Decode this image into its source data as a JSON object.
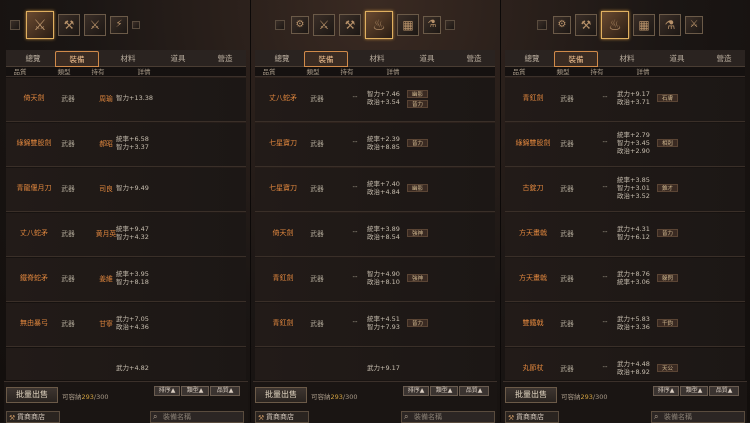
{
  "columns": {
    "grade": "品質",
    "type": "類型",
    "owner": "持有",
    "detail": "詳情"
  },
  "tabs": [
    "總覽",
    "裝備",
    "材料",
    "道具",
    "營造"
  ],
  "footer": {
    "sell": "批量出售",
    "capacity_label": "可容納",
    "capacity_used": "293",
    "capacity_total": "/300",
    "sort": [
      "排序▲",
      "類型▲",
      "品質▲"
    ],
    "shop": "貨商商店",
    "search_placeholder": "裝備名稱"
  },
  "panels": [
    {
      "rows": [
        {
          "name": "倚天劍",
          "type": "武器",
          "owner": "周瑜",
          "owner_color": "#e0863e",
          "stats": [
            "智力+13.38"
          ],
          "badge": ""
        },
        {
          "name": "綠錦雙股劍",
          "type": "武器",
          "owner": "郝昭",
          "owner_color": "#e0863e",
          "stats": [
            "統率+6.58",
            "智力+3.37"
          ],
          "badge": ""
        },
        {
          "name": "青龍偃月刀",
          "type": "武器",
          "owner": "司良",
          "owner_color": "#e0863e",
          "stats": [
            "智力+9.49"
          ],
          "badge": ""
        },
        {
          "name": "丈八蛇矛",
          "type": "武器",
          "owner": "黄月英",
          "owner_color": "#e0863e",
          "stats": [
            "統率+9.47",
            "智力+4.32"
          ],
          "badge": ""
        },
        {
          "name": "鐵脊蛇矛",
          "type": "武器",
          "owner": "姜維",
          "owner_color": "#e0863e",
          "stats": [
            "統率+3.95",
            "智力+8.18"
          ],
          "badge": ""
        },
        {
          "name": "無由暴弓",
          "type": "武器",
          "owner": "甘寧",
          "owner_color": "#e0863e",
          "stats": [
            "武力+7.05",
            "政治+4.36"
          ],
          "badge": ""
        },
        {
          "name": "",
          "type": "",
          "owner": "",
          "owner_color": "#e0863e",
          "stats": [
            "武力+4.82"
          ],
          "badge": ""
        }
      ]
    },
    {
      "rows": [
        {
          "name": "丈八蛇矛",
          "type": "武器",
          "owner": "--",
          "owner_color": "#a8a090",
          "stats": [
            "智力+7.46",
            "政治+3.54"
          ],
          "badges": [
            "幽影",
            "皆力"
          ]
        },
        {
          "name": "七星寶刀",
          "type": "武器",
          "owner": "--",
          "owner_color": "#a8a090",
          "stats": [
            "統率+2.39",
            "政治+8.85"
          ],
          "badges": [
            "皆力"
          ]
        },
        {
          "name": "七星寶刀",
          "type": "武器",
          "owner": "--",
          "owner_color": "#a8a090",
          "stats": [
            "統率+7.40",
            "政治+4.84"
          ],
          "badges": [
            "幽影"
          ]
        },
        {
          "name": "倚天劍",
          "type": "武器",
          "owner": "--",
          "owner_color": "#a8a090",
          "stats": [
            "統率+3.89",
            "政治+8.54"
          ],
          "badges": [
            "強神"
          ]
        },
        {
          "name": "青釭劍",
          "type": "武器",
          "owner": "--",
          "owner_color": "#a8a090",
          "stats": [
            "智力+4.90",
            "政治+8.10"
          ],
          "badges": [
            "強神"
          ]
        },
        {
          "name": "青釭劍",
          "type": "武器",
          "owner": "--",
          "owner_color": "#a8a090",
          "stats": [
            "統率+4.51",
            "智力+7.93"
          ],
          "badges": [
            "皆力"
          ]
        },
        {
          "name": "",
          "type": "",
          "owner": "",
          "owner_color": "#a8a090",
          "stats": [
            "武力+9.17"
          ],
          "badges": []
        }
      ]
    },
    {
      "rows": [
        {
          "name": "青釭劍",
          "type": "武器",
          "owner": "--",
          "owner_color": "#a8a090",
          "stats": [
            "武力+9.17",
            "政治+3.71"
          ],
          "badges": [
            "石膚"
          ]
        },
        {
          "name": "綠錦雙股劍",
          "type": "武器",
          "owner": "--",
          "owner_color": "#a8a090",
          "stats": [
            "統率+2.79",
            "智力+3.45",
            "政治+2.90"
          ],
          "badges": [
            "相剋"
          ]
        },
        {
          "name": "古錠刀",
          "type": "武器",
          "owner": "--",
          "owner_color": "#a8a090",
          "stats": [
            "統率+3.85",
            "智力+3.01",
            "政治+3.52"
          ],
          "badges": [
            "錐才"
          ]
        },
        {
          "name": "方天畫戟",
          "type": "武器",
          "owner": "--",
          "owner_color": "#a8a090",
          "stats": [
            "武力+4.31",
            "智力+6.12"
          ],
          "badges": [
            "皆力"
          ]
        },
        {
          "name": "方天畫戟",
          "type": "武器",
          "owner": "--",
          "owner_color": "#a8a090",
          "stats": [
            "武力+8.76",
            "統率+3.06"
          ],
          "badges": [
            "躲閃"
          ]
        },
        {
          "name": "雙鐵戟",
          "type": "武器",
          "owner": "--",
          "owner_color": "#a8a090",
          "stats": [
            "武力+5.83",
            "政治+3.36"
          ],
          "badges": [
            "千鈞"
          ]
        },
        {
          "name": "丸節杖",
          "type": "武器",
          "owner": "--",
          "owner_color": "#a8a090",
          "stats": [
            "武力+4.48",
            "政治+8.92"
          ],
          "badges": [
            "天公"
          ]
        }
      ]
    }
  ]
}
